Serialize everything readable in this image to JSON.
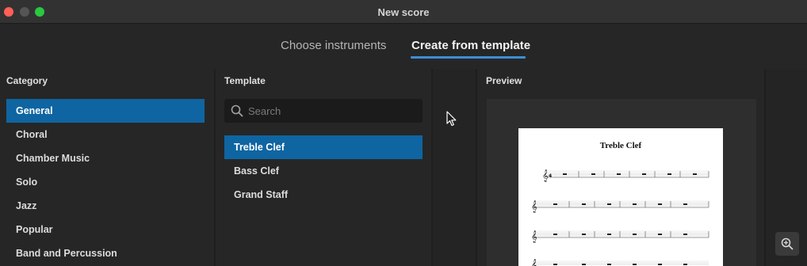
{
  "window": {
    "title": "New score"
  },
  "tabs": [
    {
      "label": "Choose instruments"
    },
    {
      "label": "Create from template"
    }
  ],
  "category": {
    "header": "Category",
    "items": [
      {
        "label": "General"
      },
      {
        "label": "Choral"
      },
      {
        "label": "Chamber Music"
      },
      {
        "label": "Solo"
      },
      {
        "label": "Jazz"
      },
      {
        "label": "Popular"
      },
      {
        "label": "Band and Percussion"
      }
    ],
    "selected": "General"
  },
  "template": {
    "header": "Template",
    "search_placeholder": "Search",
    "items": [
      {
        "label": "Treble Clef"
      },
      {
        "label": "Bass Clef"
      },
      {
        "label": "Grand Staff"
      }
    ],
    "selected": "Treble Clef"
  },
  "preview": {
    "header": "Preview",
    "score_title": "Treble Clef"
  },
  "icons": {
    "search": "search-icon",
    "zoom": "zoom-in-icon",
    "cursor": "mouse-pointer-icon"
  },
  "colors": {
    "accent": "#3d8fd6",
    "selection": "#0f65a1"
  }
}
